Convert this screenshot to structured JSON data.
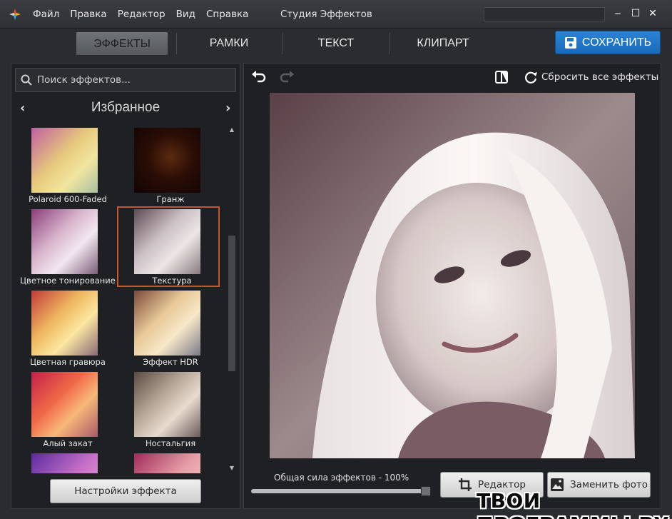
{
  "window": {
    "title": "Студия Эффектов",
    "menu": [
      "Файл",
      "Правка",
      "Редактор",
      "Вид",
      "Справка"
    ],
    "minimize": "‒",
    "maximize": "☐",
    "close": "✕"
  },
  "tabs": {
    "effects": "ЭФФЕКТЫ",
    "frames": "РАМКИ",
    "text": "ТЕКСТ",
    "clipart": "КЛИПАРТ",
    "active": "effects"
  },
  "save": {
    "label": "СОХРАНИТЬ"
  },
  "left": {
    "search_placeholder": "Поиск эффектов...",
    "category": "Избранное",
    "prev": "‹",
    "next": "›",
    "thumbnails": [
      {
        "label": "Polaroid 600-Faded"
      },
      {
        "label": "Гранж"
      },
      {
        "label": "Цветное тонирование"
      },
      {
        "label": "Текстура",
        "selected": true
      },
      {
        "label": "Цветная гравюра"
      },
      {
        "label": "Эффект HDR"
      },
      {
        "label": "Алый закат"
      },
      {
        "label": "Ностальгия"
      },
      {
        "label": ""
      },
      {
        "label": ""
      }
    ],
    "settings_button": "Настройки эффекта"
  },
  "right": {
    "reset_label": "Сбросить все эффекты",
    "strength_label": "Общая сила эффектов - 100%",
    "strength_value": 100,
    "editor_button": "Редактор",
    "replace_button": "Заменить фото"
  },
  "watermark": "ТВОИ ПРОГРАММЫ РУ",
  "colors": {
    "accent_blue": "#1f74c8",
    "selection": "#c4552c",
    "panel": "#1f2023"
  }
}
